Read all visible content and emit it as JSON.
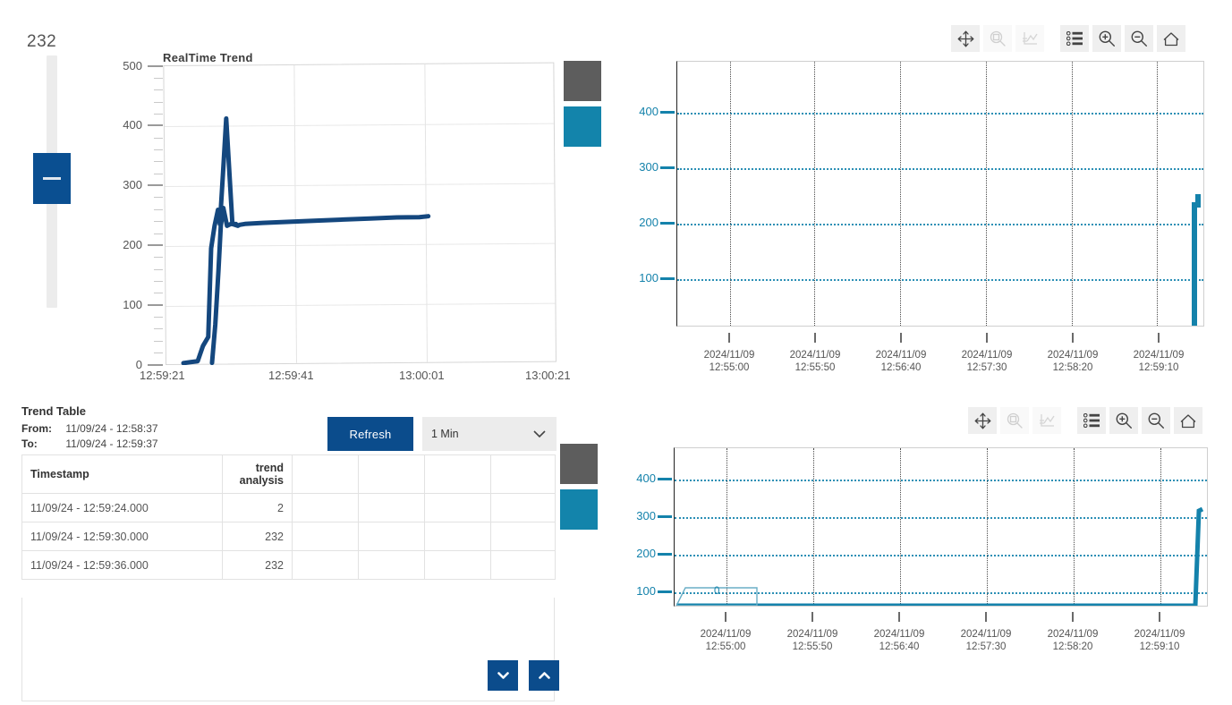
{
  "slider": {
    "value": "232",
    "name": "vertical-value-slider"
  },
  "realtime_chart": {
    "title": "RealTime Trend",
    "y_ticks": [
      "500",
      "400",
      "300",
      "200",
      "100",
      "0"
    ],
    "x_ticks": [
      "12:59:21",
      "12:59:41",
      "13:00:01",
      "13:00:21"
    ]
  },
  "legend": {
    "gray": "#5d5d5d",
    "teal": "#1384ab"
  },
  "trend_table": {
    "title": "Trend Table",
    "from_label": "From:",
    "from_value": "11/09/24 - 12:58:37",
    "to_label": "To:",
    "to_value": "11/09/24 - 12:59:37",
    "refresh_label": "Refresh",
    "interval_value": "1 Min",
    "interval_options": [
      "1 Min"
    ],
    "columns": [
      "Timestamp",
      "trend analysis",
      "",
      "",
      "",
      ""
    ],
    "column_header_0": "Timestamp",
    "column_header_1": "trend\nanalysis",
    "rows": [
      {
        "timestamp": "11/09/24 - 12:59:24.000",
        "value": "2"
      },
      {
        "timestamp": "11/09/24 - 12:59:30.000",
        "value": "232"
      },
      {
        "timestamp": "11/09/24 - 12:59:36.000",
        "value": "232"
      }
    ],
    "scroll_down": "˅",
    "scroll_up": "˄"
  },
  "toolbar": {
    "items": [
      {
        "name": "pan-icon",
        "label": "Pan",
        "disabled": false
      },
      {
        "name": "zoom-box-icon",
        "label": "Zoom Box",
        "disabled": true
      },
      {
        "name": "axis-reset-icon",
        "label": "Reset Axis",
        "disabled": true
      },
      {
        "name": "legend-list-icon",
        "label": "Legend",
        "disabled": false
      },
      {
        "name": "zoom-in-icon",
        "label": "Zoom In",
        "disabled": false
      },
      {
        "name": "zoom-out-icon",
        "label": "Zoom Out",
        "disabled": false
      },
      {
        "name": "home-icon",
        "label": "Home",
        "disabled": false
      }
    ]
  },
  "history_chart_top": {
    "y_ticks": [
      "400",
      "300",
      "200",
      "100"
    ],
    "x_ticks": [
      {
        "date": "2024/11/09",
        "time": "12:55:00"
      },
      {
        "date": "2024/11/09",
        "time": "12:55:50"
      },
      {
        "date": "2024/11/09",
        "time": "12:56:40"
      },
      {
        "date": "2024/11/09",
        "time": "12:57:30"
      },
      {
        "date": "2024/11/09",
        "time": "12:58:20"
      },
      {
        "date": "2024/11/09",
        "time": "12:59:10"
      }
    ]
  },
  "history_chart_bottom": {
    "y_ticks": [
      "400",
      "300",
      "200",
      "100"
    ],
    "x_ticks": [
      {
        "date": "2024/11/09",
        "time": "12:55:00"
      },
      {
        "date": "2024/11/09",
        "time": "12:55:50"
      },
      {
        "date": "2024/11/09",
        "time": "12:56:40"
      },
      {
        "date": "2024/11/09",
        "time": "12:57:30"
      },
      {
        "date": "2024/11/09",
        "time": "12:58:20"
      },
      {
        "date": "2024/11/09",
        "time": "12:59:10"
      }
    ],
    "data_label": "0"
  },
  "chart_data": [
    {
      "type": "line",
      "id": "realtime-trend",
      "title": "RealTime Trend",
      "xlabel": "",
      "ylabel": "",
      "ylim": [
        0,
        500
      ],
      "grid": true,
      "legend": "none",
      "series": [
        {
          "name": "trend analysis",
          "color": "#14477e",
          "x": [
            "12:59:21",
            "12:59:23",
            "12:59:24",
            "12:59:25",
            "12:59:26",
            "12:59:30",
            "12:59:36",
            "12:59:41",
            "12:59:50",
            "12:59:55"
          ],
          "values": [
            0,
            2,
            10,
            30,
            195,
            232,
            232,
            232,
            236,
            238
          ]
        }
      ],
      "x_tick_labels": [
        "12:59:21",
        "12:59:41",
        "13:00:01",
        "13:00:21"
      ],
      "y_tick_labels": [
        "0",
        "100",
        "200",
        "300",
        "400",
        "500"
      ]
    },
    {
      "type": "line",
      "id": "history-trend-top",
      "title": "",
      "xlabel": "",
      "ylabel": "",
      "ylim": [
        0,
        480
      ],
      "grid": true,
      "legend": "none",
      "series": [
        {
          "name": "trend analysis",
          "color": "#1482ab",
          "x": [
            "12:55:00",
            "12:56:40",
            "12:58:20",
            "12:59:10",
            "12:59:24",
            "12:59:30",
            "12:59:36"
          ],
          "values": [
            0,
            0,
            0,
            0,
            2,
            232,
            232
          ]
        }
      ],
      "x_tick_labels": [
        "2024/11/09 12:55:00",
        "2024/11/09 12:55:50",
        "2024/11/09 12:56:40",
        "2024/11/09 12:57:30",
        "2024/11/09 12:58:20",
        "2024/11/09 12:59:10"
      ],
      "y_tick_labels": [
        "100",
        "200",
        "300",
        "400"
      ]
    },
    {
      "type": "line",
      "id": "history-trend-bottom",
      "title": "",
      "xlabel": "",
      "ylabel": "",
      "ylim": [
        0,
        480
      ],
      "grid": true,
      "legend": "none",
      "annotations": [
        {
          "text": "0",
          "x": "12:55:20",
          "y": 20
        }
      ],
      "series": [
        {
          "name": "trend analysis",
          "color": "#1482ab",
          "x": [
            "12:55:00",
            "12:56:40",
            "12:58:20",
            "12:59:10",
            "12:59:24",
            "12:59:30",
            "12:59:36"
          ],
          "values": [
            0,
            0,
            0,
            0,
            2,
            232,
            232
          ]
        }
      ],
      "x_tick_labels": [
        "2024/11/09 12:55:00",
        "2024/11/09 12:55:50",
        "2024/11/09 12:56:40",
        "2024/11/09 12:57:30",
        "2024/11/09 12:58:20",
        "2024/11/09 12:59:10"
      ],
      "y_tick_labels": [
        "100",
        "200",
        "300",
        "400"
      ]
    }
  ]
}
